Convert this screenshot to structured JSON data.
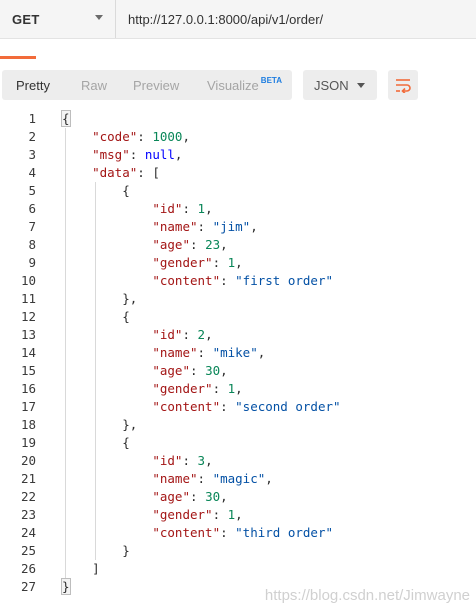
{
  "request": {
    "method": "GET",
    "url": "http://127.0.0.1:8000/api/v1/order/"
  },
  "view_tabs": [
    {
      "label": "Pretty",
      "active": true
    },
    {
      "label": "Raw",
      "active": false
    },
    {
      "label": "Preview",
      "active": false
    },
    {
      "label": "Visualize",
      "active": false,
      "badge": "BETA"
    }
  ],
  "format": {
    "selected": "JSON"
  },
  "icons": {
    "wrap": "wrap-lines-icon",
    "method_dropdown": "chevron-down-icon",
    "format_dropdown": "chevron-down-icon"
  },
  "colors": {
    "accent": "#f26b3a",
    "beta": "#1f7ee0",
    "json_key": "#a31515",
    "json_string": "#0451a5",
    "json_number": "#098658",
    "json_null": "#0000ff"
  },
  "response_json": {
    "code": 1000,
    "msg": null,
    "data": [
      {
        "id": 1,
        "name": "jim",
        "age": 23,
        "gender": 1,
        "content": "first order"
      },
      {
        "id": 2,
        "name": "mike",
        "age": 30,
        "gender": 1,
        "content": "second order"
      },
      {
        "id": 3,
        "name": "magic",
        "age": 30,
        "gender": 1,
        "content": "third order"
      }
    ]
  },
  "watermark": "https://blog.csdn.net/Jimwayne"
}
